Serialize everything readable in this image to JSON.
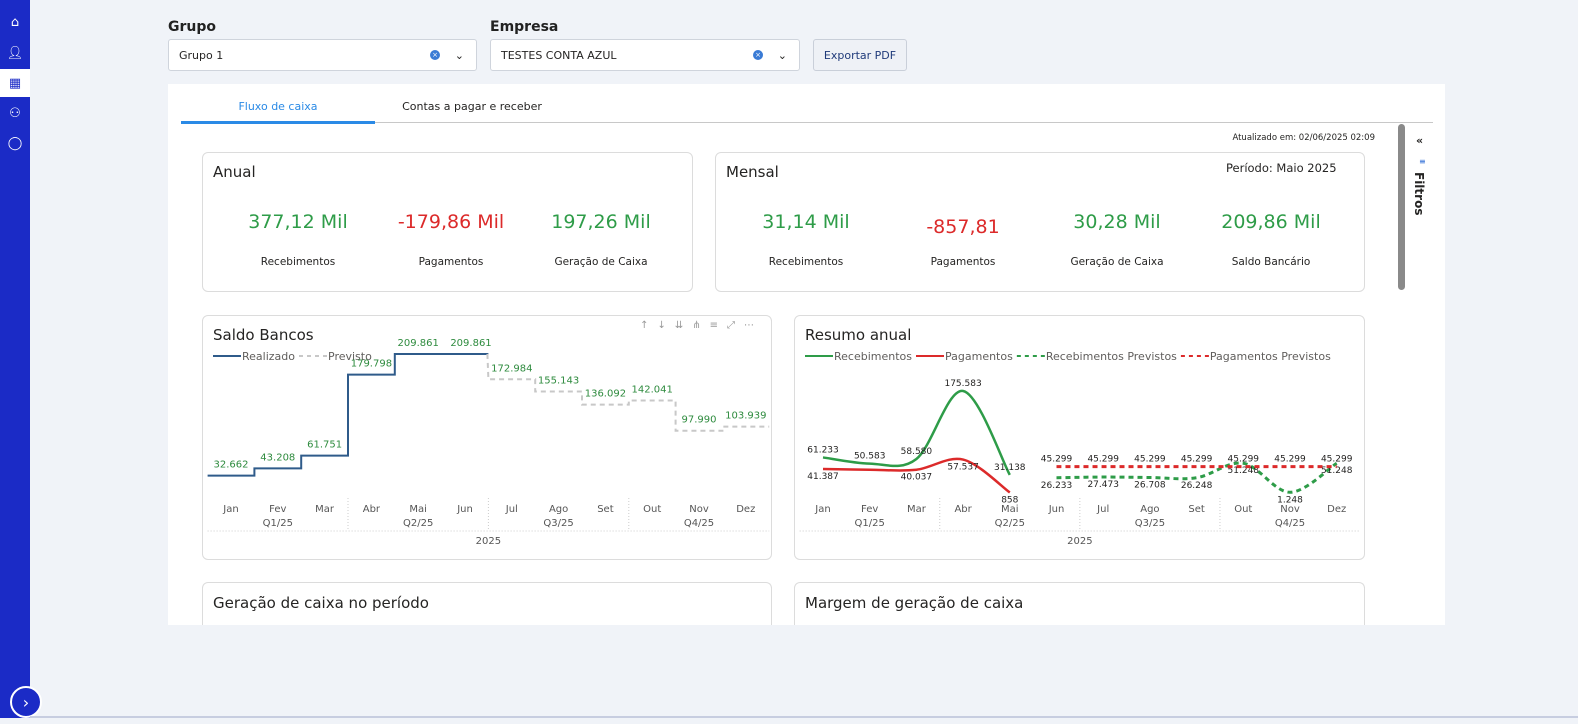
{
  "sidebar": {
    "items": [
      {
        "icon": "home-icon"
      },
      {
        "icon": "user-icon"
      },
      {
        "icon": "dashboard-grid-icon",
        "active": true
      },
      {
        "icon": "users-icon"
      },
      {
        "icon": "chat-icon"
      }
    ],
    "expand_icon": "chevron-right-icon"
  },
  "filters": {
    "grupo_label": "Grupo",
    "grupo_value": "Grupo 1",
    "empresa_label": "Empresa",
    "empresa_value": "TESTES CONTA AZUL",
    "export_label": "Exportar PDF"
  },
  "tabs": [
    {
      "label": "Fluxo de caixa",
      "active": true
    },
    {
      "label": "Contas a pagar e receber"
    }
  ],
  "updated": "Atualizado em: 02/06/2025 02:09",
  "side_panel": {
    "collapse": "«",
    "label": "Filtros"
  },
  "anual": {
    "title": "Anual",
    "kpis": [
      {
        "value": "377,12 Mil",
        "label": "Recebimentos",
        "color": "#2e9c48"
      },
      {
        "value": "-179,86 Mil",
        "label": "Pagamentos",
        "color": "#dc2a2a"
      },
      {
        "value": "197,26 Mil",
        "label": "Geração de Caixa",
        "color": "#2e9c48"
      }
    ]
  },
  "mensal": {
    "title": "Mensal",
    "period": "Período: Maio 2025",
    "kpis": [
      {
        "value": "31,14 Mil",
        "label": "Recebimentos",
        "color": "#2e9c48"
      },
      {
        "value": "-857,81",
        "label": "Pagamentos",
        "color": "#dc2a2a"
      },
      {
        "value": "30,28 Mil",
        "label": "Geração de Caixa",
        "color": "#2e9c48"
      },
      {
        "value": "209,86 Mil",
        "label": "Saldo Bancário",
        "color": "#2e9c48"
      }
    ]
  },
  "bottom_cards": {
    "left": "Geração de caixa no período",
    "right": "Margem de geração de caixa"
  },
  "chart_data": [
    {
      "type": "line",
      "title": "Saldo Bancos",
      "step": true,
      "categories": [
        "Jan",
        "Fev",
        "Mar",
        "Abr",
        "Mai",
        "Jun",
        "Jul",
        "Ago",
        "Set",
        "Out",
        "Nov",
        "Dez"
      ],
      "quarters": [
        "Q1/25",
        "Q2/25",
        "Q3/25",
        "Q4/25"
      ],
      "year": "2025",
      "ylim": [
        0,
        220000
      ],
      "grid": false,
      "legend": "top-left",
      "series": [
        {
          "name": "Realizado",
          "color": "#2f5b8a",
          "style": "solid",
          "values": [
            32662,
            43208,
            61751,
            179798,
            209861,
            209861,
            null,
            null,
            null,
            null,
            null,
            null
          ]
        },
        {
          "name": "Previsto",
          "color": "#c8c8c8",
          "style": "dashed",
          "values": [
            null,
            null,
            null,
            null,
            null,
            209861,
            172984,
            155143,
            136092,
            142041,
            97990,
            103939
          ]
        }
      ],
      "labels": [
        "32.662",
        "43.208",
        "61.751",
        "179.798",
        "209.861",
        "209.861",
        "172.984",
        "155.143",
        "136.092",
        "142.041",
        "97.990",
        "103.939"
      ]
    },
    {
      "type": "line",
      "title": "Resumo anual",
      "smooth": true,
      "categories": [
        "Jan",
        "Fev",
        "Mar",
        "Abr",
        "Mai",
        "Jun",
        "Jul",
        "Ago",
        "Set",
        "Out",
        "Nov",
        "Dez"
      ],
      "quarters": [
        "Q1/25",
        "Q2/25",
        "Q3/25",
        "Q4/25"
      ],
      "year": "2025",
      "ylim": [
        0,
        180000
      ],
      "grid": false,
      "legend": "top-left",
      "series": [
        {
          "name": "Recebimentos",
          "color": "#2e9c48",
          "style": "solid",
          "values": [
            61233,
            50583,
            58580,
            175583,
            31138,
            null,
            null,
            null,
            null,
            null,
            null,
            null
          ]
        },
        {
          "name": "Pagamentos",
          "color": "#dc2a2a",
          "style": "solid",
          "values": [
            41387,
            40037,
            40037,
            57537,
            858,
            null,
            null,
            null,
            null,
            null,
            null,
            null
          ]
        },
        {
          "name": "Recebimentos Previstos",
          "color": "#2e9c48",
          "style": "dashed",
          "values": [
            null,
            null,
            null,
            null,
            null,
            26233,
            27473,
            26708,
            26248,
            51248,
            1248,
            51248
          ]
        },
        {
          "name": "Pagamentos Previstos",
          "color": "#dc2a2a",
          "style": "dashed",
          "values": [
            null,
            null,
            null,
            null,
            null,
            45299,
            45299,
            45299,
            45299,
            45299,
            45299,
            45299
          ]
        }
      ],
      "labels": [
        [
          "61.233",
          "50.583",
          "58.580",
          "175.583",
          "31.138"
        ],
        [
          "41.387",
          null,
          "40.037",
          "57.537",
          "858"
        ],
        [
          "26.233",
          "27.473",
          "26.708",
          "26.248",
          "51.248",
          "1.248",
          "51.248"
        ],
        [
          "45.299",
          "45.299",
          "45.299",
          "45.299",
          "45.299",
          "45.299",
          "45.299"
        ]
      ]
    }
  ]
}
